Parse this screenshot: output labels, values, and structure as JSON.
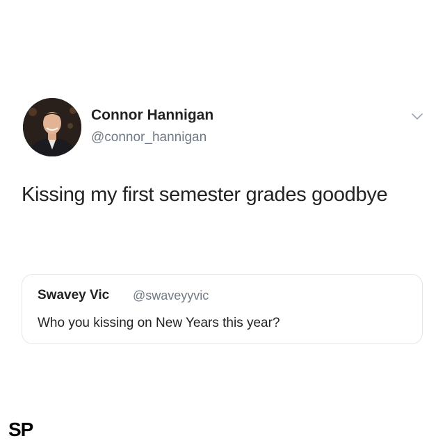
{
  "tweet": {
    "author_name": "Connor Hannigan",
    "author_handle": "@connor_hannigan",
    "text": "Kissing my first semester grades goodbye",
    "avatar_icon": "profile-photo",
    "menu_icon": "chevron-down-icon"
  },
  "quoted_tweet": {
    "author_name": "Swavey Vic",
    "author_handle": "@swaveyyvic",
    "text": "Who you kissing on New Years this year?"
  },
  "watermark": {
    "text": "SP"
  },
  "colors": {
    "text": "#222222",
    "secondary_text": "#6f7a84",
    "border": "#e3e6e9",
    "background": "#ffffff"
  }
}
